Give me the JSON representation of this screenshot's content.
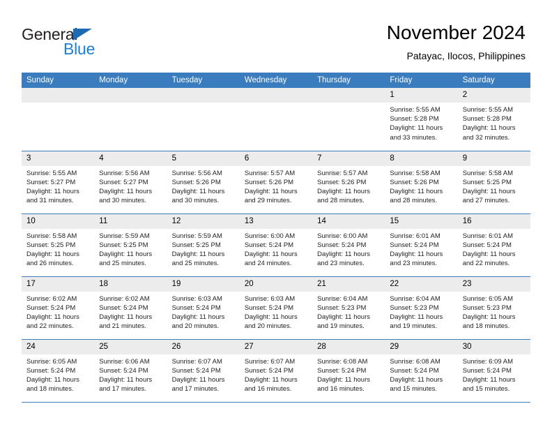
{
  "brand": {
    "name_dark": "General",
    "name_blue": "Blue",
    "accent_blue": "#1c7fd4",
    "triangle_blue": "#1c6cb5"
  },
  "header": {
    "title": "November 2024",
    "subtitle": "Patayac, Ilocos, Philippines"
  },
  "theme": {
    "header_row_bg": "#3a7cbe",
    "daynum_bg": "#ececec",
    "grid_line": "#3a7cbe",
    "text": "#000000"
  },
  "weekday_headers": [
    "Sunday",
    "Monday",
    "Tuesday",
    "Wednesday",
    "Thursday",
    "Friday",
    "Saturday"
  ],
  "labels": {
    "sunrise_prefix": "Sunrise:",
    "sunset_prefix": "Sunset:",
    "daylight_prefix": "Daylight:"
  },
  "weeks": [
    [
      {
        "day": "",
        "empty": true,
        "line1": "",
        "line2": "",
        "line3": "",
        "line4": ""
      },
      {
        "day": "",
        "empty": true,
        "line1": "",
        "line2": "",
        "line3": "",
        "line4": ""
      },
      {
        "day": "",
        "empty": true,
        "line1": "",
        "line2": "",
        "line3": "",
        "line4": ""
      },
      {
        "day": "",
        "empty": true,
        "line1": "",
        "line2": "",
        "line3": "",
        "line4": ""
      },
      {
        "day": "",
        "empty": true,
        "line1": "",
        "line2": "",
        "line3": "",
        "line4": ""
      },
      {
        "day": "1",
        "empty": false,
        "line1": "Sunrise: 5:55 AM",
        "line2": "Sunset: 5:28 PM",
        "line3": "Daylight: 11 hours",
        "line4": "and 33 minutes."
      },
      {
        "day": "2",
        "empty": false,
        "line1": "Sunrise: 5:55 AM",
        "line2": "Sunset: 5:28 PM",
        "line3": "Daylight: 11 hours",
        "line4": "and 32 minutes."
      }
    ],
    [
      {
        "day": "3",
        "empty": false,
        "line1": "Sunrise: 5:55 AM",
        "line2": "Sunset: 5:27 PM",
        "line3": "Daylight: 11 hours",
        "line4": "and 31 minutes."
      },
      {
        "day": "4",
        "empty": false,
        "line1": "Sunrise: 5:56 AM",
        "line2": "Sunset: 5:27 PM",
        "line3": "Daylight: 11 hours",
        "line4": "and 30 minutes."
      },
      {
        "day": "5",
        "empty": false,
        "line1": "Sunrise: 5:56 AM",
        "line2": "Sunset: 5:26 PM",
        "line3": "Daylight: 11 hours",
        "line4": "and 30 minutes."
      },
      {
        "day": "6",
        "empty": false,
        "line1": "Sunrise: 5:57 AM",
        "line2": "Sunset: 5:26 PM",
        "line3": "Daylight: 11 hours",
        "line4": "and 29 minutes."
      },
      {
        "day": "7",
        "empty": false,
        "line1": "Sunrise: 5:57 AM",
        "line2": "Sunset: 5:26 PM",
        "line3": "Daylight: 11 hours",
        "line4": "and 28 minutes."
      },
      {
        "day": "8",
        "empty": false,
        "line1": "Sunrise: 5:58 AM",
        "line2": "Sunset: 5:26 PM",
        "line3": "Daylight: 11 hours",
        "line4": "and 28 minutes."
      },
      {
        "day": "9",
        "empty": false,
        "line1": "Sunrise: 5:58 AM",
        "line2": "Sunset: 5:25 PM",
        "line3": "Daylight: 11 hours",
        "line4": "and 27 minutes."
      }
    ],
    [
      {
        "day": "10",
        "empty": false,
        "line1": "Sunrise: 5:58 AM",
        "line2": "Sunset: 5:25 PM",
        "line3": "Daylight: 11 hours",
        "line4": "and 26 minutes."
      },
      {
        "day": "11",
        "empty": false,
        "line1": "Sunrise: 5:59 AM",
        "line2": "Sunset: 5:25 PM",
        "line3": "Daylight: 11 hours",
        "line4": "and 25 minutes."
      },
      {
        "day": "12",
        "empty": false,
        "line1": "Sunrise: 5:59 AM",
        "line2": "Sunset: 5:25 PM",
        "line3": "Daylight: 11 hours",
        "line4": "and 25 minutes."
      },
      {
        "day": "13",
        "empty": false,
        "line1": "Sunrise: 6:00 AM",
        "line2": "Sunset: 5:24 PM",
        "line3": "Daylight: 11 hours",
        "line4": "and 24 minutes."
      },
      {
        "day": "14",
        "empty": false,
        "line1": "Sunrise: 6:00 AM",
        "line2": "Sunset: 5:24 PM",
        "line3": "Daylight: 11 hours",
        "line4": "and 23 minutes."
      },
      {
        "day": "15",
        "empty": false,
        "line1": "Sunrise: 6:01 AM",
        "line2": "Sunset: 5:24 PM",
        "line3": "Daylight: 11 hours",
        "line4": "and 23 minutes."
      },
      {
        "day": "16",
        "empty": false,
        "line1": "Sunrise: 6:01 AM",
        "line2": "Sunset: 5:24 PM",
        "line3": "Daylight: 11 hours",
        "line4": "and 22 minutes."
      }
    ],
    [
      {
        "day": "17",
        "empty": false,
        "line1": "Sunrise: 6:02 AM",
        "line2": "Sunset: 5:24 PM",
        "line3": "Daylight: 11 hours",
        "line4": "and 22 minutes."
      },
      {
        "day": "18",
        "empty": false,
        "line1": "Sunrise: 6:02 AM",
        "line2": "Sunset: 5:24 PM",
        "line3": "Daylight: 11 hours",
        "line4": "and 21 minutes."
      },
      {
        "day": "19",
        "empty": false,
        "line1": "Sunrise: 6:03 AM",
        "line2": "Sunset: 5:24 PM",
        "line3": "Daylight: 11 hours",
        "line4": "and 20 minutes."
      },
      {
        "day": "20",
        "empty": false,
        "line1": "Sunrise: 6:03 AM",
        "line2": "Sunset: 5:24 PM",
        "line3": "Daylight: 11 hours",
        "line4": "and 20 minutes."
      },
      {
        "day": "21",
        "empty": false,
        "line1": "Sunrise: 6:04 AM",
        "line2": "Sunset: 5:23 PM",
        "line3": "Daylight: 11 hours",
        "line4": "and 19 minutes."
      },
      {
        "day": "22",
        "empty": false,
        "line1": "Sunrise: 6:04 AM",
        "line2": "Sunset: 5:23 PM",
        "line3": "Daylight: 11 hours",
        "line4": "and 19 minutes."
      },
      {
        "day": "23",
        "empty": false,
        "line1": "Sunrise: 6:05 AM",
        "line2": "Sunset: 5:23 PM",
        "line3": "Daylight: 11 hours",
        "line4": "and 18 minutes."
      }
    ],
    [
      {
        "day": "24",
        "empty": false,
        "line1": "Sunrise: 6:05 AM",
        "line2": "Sunset: 5:24 PM",
        "line3": "Daylight: 11 hours",
        "line4": "and 18 minutes."
      },
      {
        "day": "25",
        "empty": false,
        "line1": "Sunrise: 6:06 AM",
        "line2": "Sunset: 5:24 PM",
        "line3": "Daylight: 11 hours",
        "line4": "and 17 minutes."
      },
      {
        "day": "26",
        "empty": false,
        "line1": "Sunrise: 6:07 AM",
        "line2": "Sunset: 5:24 PM",
        "line3": "Daylight: 11 hours",
        "line4": "and 17 minutes."
      },
      {
        "day": "27",
        "empty": false,
        "line1": "Sunrise: 6:07 AM",
        "line2": "Sunset: 5:24 PM",
        "line3": "Daylight: 11 hours",
        "line4": "and 16 minutes."
      },
      {
        "day": "28",
        "empty": false,
        "line1": "Sunrise: 6:08 AM",
        "line2": "Sunset: 5:24 PM",
        "line3": "Daylight: 11 hours",
        "line4": "and 16 minutes."
      },
      {
        "day": "29",
        "empty": false,
        "line1": "Sunrise: 6:08 AM",
        "line2": "Sunset: 5:24 PM",
        "line3": "Daylight: 11 hours",
        "line4": "and 15 minutes."
      },
      {
        "day": "30",
        "empty": false,
        "line1": "Sunrise: 6:09 AM",
        "line2": "Sunset: 5:24 PM",
        "line3": "Daylight: 11 hours",
        "line4": "and 15 minutes."
      }
    ]
  ]
}
